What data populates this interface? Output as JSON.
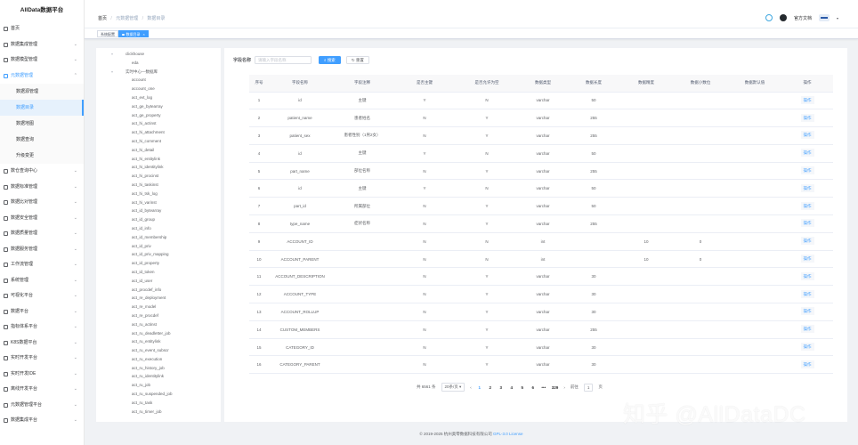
{
  "app": {
    "title": "AllData数据平台"
  },
  "sidebar": {
    "home": "首页",
    "items": [
      {
        "label": "数据集成管理",
        "open": false
      },
      {
        "label": "数据模型管理",
        "open": false
      },
      {
        "label": "元数据管理",
        "open": true,
        "children": [
          "数据源管理",
          "数据目录",
          "数据地图",
          "数据查询",
          "升级变更"
        ],
        "active_child": 1
      },
      {
        "label": "数仓查询中心",
        "open": false
      },
      {
        "label": "数据标准管理",
        "open": false
      },
      {
        "label": "数据比对管理",
        "open": false
      },
      {
        "label": "数据安全管理",
        "open": false
      },
      {
        "label": "数据质量管理",
        "open": false
      },
      {
        "label": "数据服务管理",
        "open": false
      },
      {
        "label": "工作流管理",
        "open": false
      },
      {
        "label": "系统管理",
        "open": false
      },
      {
        "label": "可视化平台",
        "open": false
      },
      {
        "label": "数据平台",
        "open": false
      },
      {
        "label": "指标体系平台",
        "open": false
      },
      {
        "label": "K8S数据平台",
        "open": false
      },
      {
        "label": "实时开发平台",
        "open": false
      },
      {
        "label": "实时开发IDE",
        "open": false
      },
      {
        "label": "离线开发平台",
        "open": false
      },
      {
        "label": "元数据管理平台",
        "open": false
      },
      {
        "label": "数据集成平台",
        "open": false
      }
    ]
  },
  "header": {
    "breadcrumb": [
      "首页",
      "元数据管理",
      "数据目录"
    ],
    "docs_label": "官方文档"
  },
  "tags": [
    {
      "label": "系统配置",
      "active": false
    },
    {
      "label": "数据目录",
      "active": true
    }
  ],
  "tree": {
    "root": "clickhouse",
    "nodes": [
      "eda",
      "实时中心—数据库",
      "account",
      "account_one",
      "act_evt_log",
      "act_ge_bytearray",
      "act_ge_property",
      "act_hi_actinst",
      "act_hi_attachment",
      "act_hi_comment",
      "act_hi_detail",
      "act_hi_entitylink",
      "act_hi_identitylink",
      "act_hi_procinst",
      "act_hi_taskinst",
      "act_hi_tsk_log",
      "act_hi_varinst",
      "act_id_bytearray",
      "act_id_group",
      "act_id_info",
      "act_id_membership",
      "act_id_priv",
      "act_id_priv_mapping",
      "act_id_property",
      "act_id_token",
      "act_id_user",
      "act_procdef_info",
      "act_re_deployment",
      "act_re_model",
      "act_re_procdef",
      "act_ru_actinst",
      "act_ru_deadletter_job",
      "act_ru_entitylink",
      "act_ru_event_subscr",
      "act_ru_execution",
      "act_ru_history_job",
      "act_ru_identitylink",
      "act_ru_job",
      "act_ru_suspended_job",
      "act_ru_task",
      "act_ru_timer_job"
    ]
  },
  "search": {
    "label": "字段名称",
    "placeholder": "请输入字段名称",
    "search_btn": "搜索",
    "reset_btn": "重置"
  },
  "table": {
    "headers": [
      "序号",
      "字段名称",
      "字段注释",
      "是否主键",
      "是否允许为空",
      "数据类型",
      "数据长度",
      "数据精度",
      "数据小数位",
      "数据默认值",
      "操作"
    ],
    "op_label": "操作",
    "rows": [
      [
        "1",
        "id",
        "主键",
        "Y",
        "N",
        "varchar",
        "50",
        "",
        "",
        "",
        ""
      ],
      [
        "2",
        "patient_name",
        "患者姓名",
        "N",
        "Y",
        "varchar",
        "255",
        "",
        "",
        "",
        ""
      ],
      [
        "3",
        "patient_sex",
        "患者性别（1男2女）",
        "N",
        "Y",
        "varchar",
        "255",
        "",
        "",
        "",
        ""
      ],
      [
        "4",
        "id",
        "主键",
        "Y",
        "N",
        "varchar",
        "50",
        "",
        "",
        "",
        ""
      ],
      [
        "5",
        "part_name",
        "部位名称",
        "N",
        "Y",
        "varchar",
        "255",
        "",
        "",
        "",
        ""
      ],
      [
        "6",
        "id",
        "主键",
        "Y",
        "N",
        "varchar",
        "50",
        "",
        "",
        "",
        ""
      ],
      [
        "7",
        "part_id",
        "所属部位",
        "N",
        "Y",
        "varchar",
        "50",
        "",
        "",
        "",
        ""
      ],
      [
        "8",
        "type_name",
        "症状名称",
        "N",
        "Y",
        "varchar",
        "255",
        "",
        "",
        "",
        ""
      ],
      [
        "9",
        "ACCOUNT_ID",
        "",
        "N",
        "N",
        "int",
        "",
        "10",
        "0",
        "",
        ""
      ],
      [
        "10",
        "ACCOUNT_PARENT",
        "",
        "N",
        "N",
        "int",
        "",
        "10",
        "0",
        "",
        ""
      ],
      [
        "11",
        "ACCOUNT_DESCRIPTION",
        "",
        "N",
        "Y",
        "varchar",
        "30",
        "",
        "",
        "",
        ""
      ],
      [
        "12",
        "ACCOUNT_TYPE",
        "",
        "N",
        "Y",
        "varchar",
        "30",
        "",
        "",
        "",
        ""
      ],
      [
        "13",
        "ACCOUNT_ROLLUP",
        "",
        "N",
        "Y",
        "varchar",
        "30",
        "",
        "",
        "",
        ""
      ],
      [
        "14",
        "CUSTOM_MEMBERS",
        "",
        "N",
        "Y",
        "varchar",
        "255",
        "",
        "",
        "",
        ""
      ],
      [
        "15",
        "CATEGORY_ID",
        "",
        "N",
        "Y",
        "varchar",
        "30",
        "",
        "",
        "",
        ""
      ],
      [
        "16",
        "CATEGORY_PARENT",
        "",
        "N",
        "Y",
        "varchar",
        "30",
        "",
        "",
        "",
        ""
      ]
    ]
  },
  "pagination": {
    "total": "共 6561 条",
    "page_size": "20条/页",
    "prev": "‹",
    "pages": [
      "1",
      "2",
      "3",
      "4",
      "5",
      "6",
      "•••",
      "329"
    ],
    "active_page": 0,
    "next": "›",
    "goto_label": "前往",
    "goto_value": "1",
    "page_suffix": "页"
  },
  "footer": {
    "copyright": "© 2019-2025 杭州奥零数据科技有限公司",
    "license": "GPL-3.0 License"
  },
  "watermark": "知乎 @AllDataDC",
  "colors": {
    "primary": "#409eff",
    "sidebar_bg": "#ffffff",
    "page_bg": "#f0f2f5"
  }
}
